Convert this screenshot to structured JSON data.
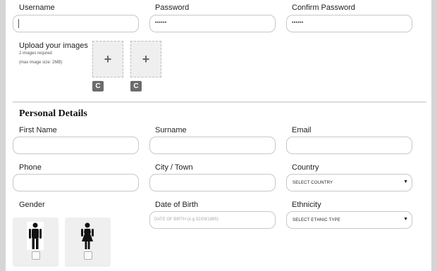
{
  "account": {
    "username_label": "Username",
    "password_label": "Password",
    "confirm_label": "Confirm Password",
    "password_value": "••••••",
    "confirm_value": "••••••"
  },
  "upload": {
    "title": "Upload your images",
    "hint1": "2 images requred",
    "hint2": "(max image size: 2MB)",
    "plus": "+",
    "refresh": "C"
  },
  "personal": {
    "title": "Personal Details",
    "first_name_label": "First Name",
    "surname_label": "Surname",
    "email_label": "Email",
    "phone_label": "Phone",
    "city_label": "City / Town",
    "country_label": "Country",
    "country_value": "SELECT COUNTRY",
    "gender_label": "Gender",
    "dob_label": "Date of Birth",
    "dob_placeholder": "DATE OF BIRTH (e.g 02/09/1985)",
    "ethnicity_label": "Ethnicity",
    "ethnicity_value": "SELECT ETHNIC TYPE",
    "arrow": "▼"
  }
}
